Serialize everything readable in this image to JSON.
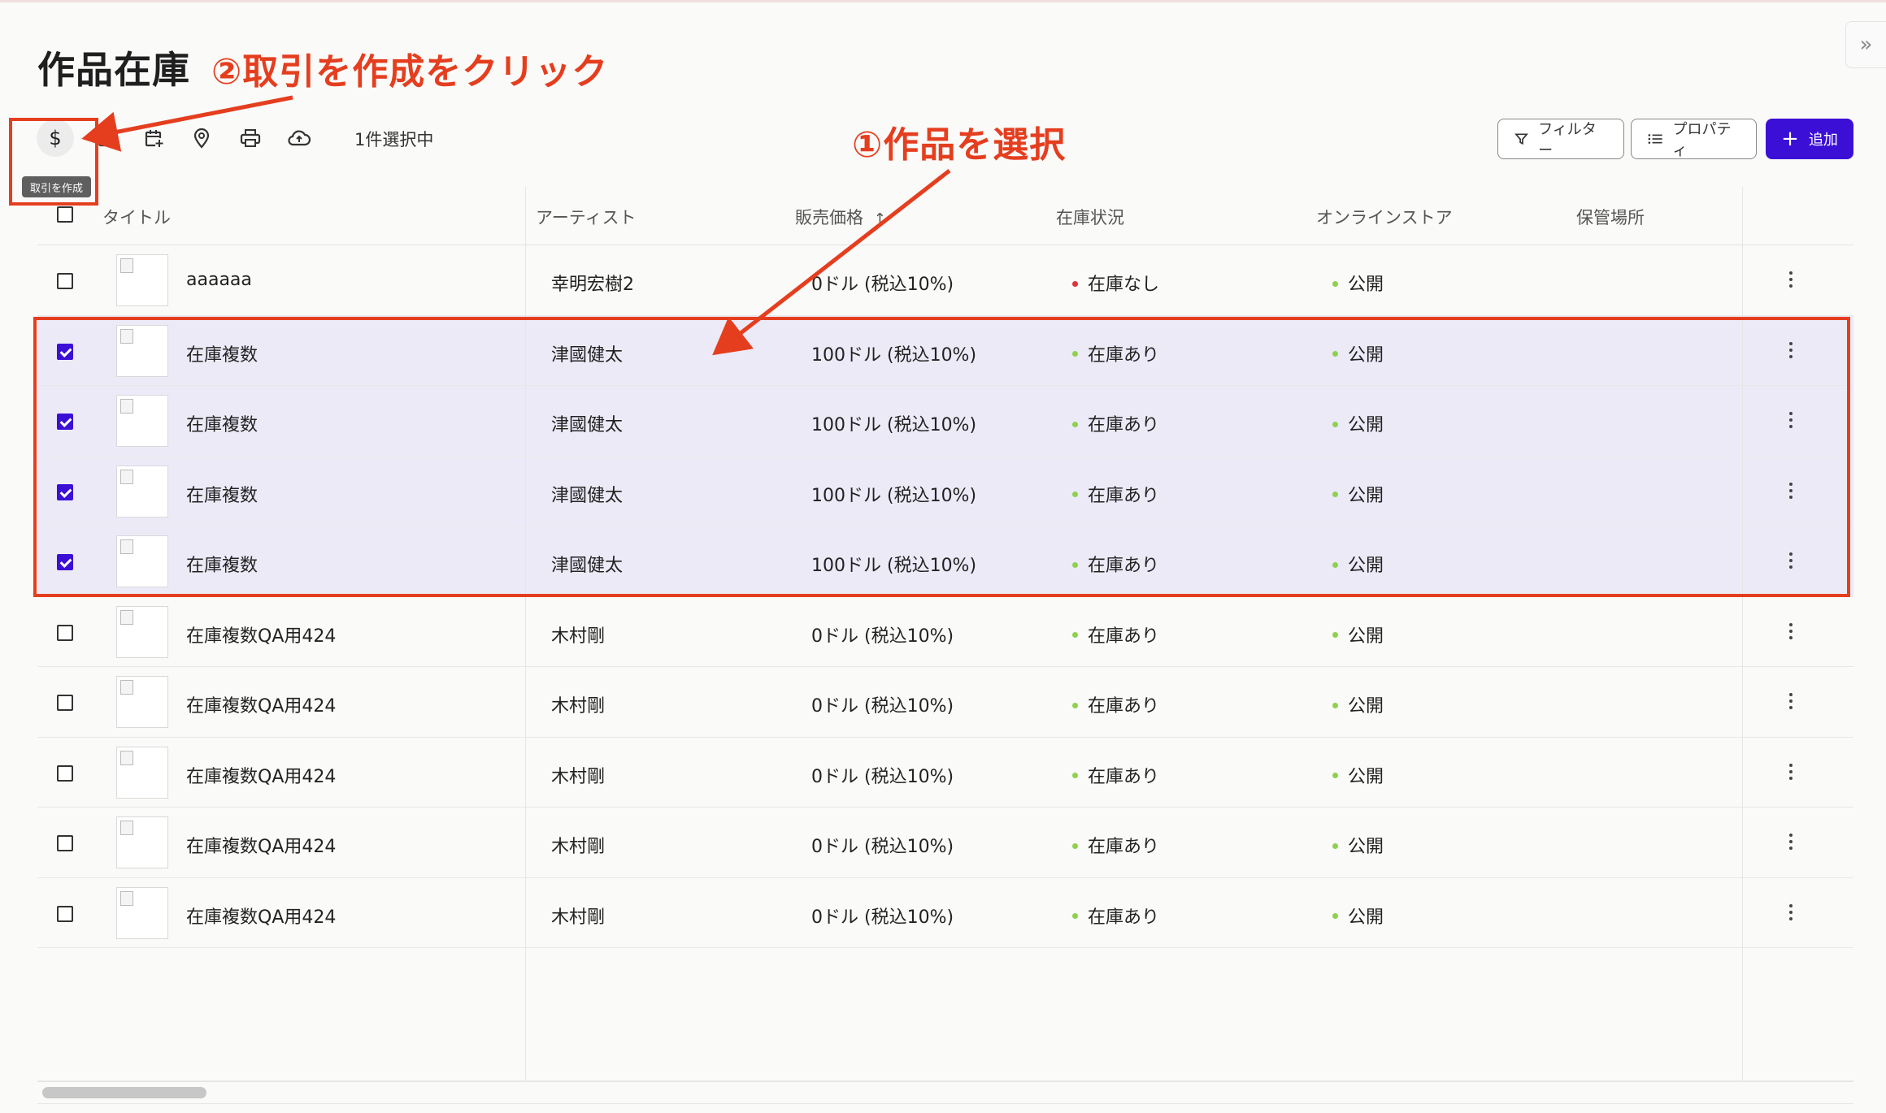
{
  "page_title": "作品在庫",
  "toolbar": {
    "tooltip": "取引を作成",
    "selection_count": "1件選択中",
    "filter_label": "フィルター",
    "property_label": "プロパティ",
    "add_label": "追加"
  },
  "annotations": {
    "step2": "②取引を作成をクリック",
    "step1": "①作品を選択"
  },
  "table": {
    "headers": {
      "title": "タイトル",
      "artist": "アーティスト",
      "price": "販売価格",
      "stock": "在庫状況",
      "store": "オンラインストア",
      "location": "保管場所"
    },
    "rows": [
      {
        "title": "aaaaaa",
        "artist": "幸明宏樹2",
        "price": "0ドル (税込10%)",
        "stock": "在庫なし",
        "store": "公開",
        "checked": false
      },
      {
        "title": "在庫複数",
        "artist": "津國健太",
        "price": "100ドル (税込10%)",
        "stock": "在庫あり",
        "store": "公開",
        "checked": true
      },
      {
        "title": "在庫複数",
        "artist": "津國健太",
        "price": "100ドル (税込10%)",
        "stock": "在庫あり",
        "store": "公開",
        "checked": true
      },
      {
        "title": "在庫複数",
        "artist": "津國健太",
        "price": "100ドル (税込10%)",
        "stock": "在庫あり",
        "store": "公開",
        "checked": true
      },
      {
        "title": "在庫複数",
        "artist": "津國健太",
        "price": "100ドル (税込10%)",
        "stock": "在庫あり",
        "store": "公開",
        "checked": true
      },
      {
        "title": "在庫複数QA用424",
        "artist": "木村剛",
        "price": "0ドル (税込10%)",
        "stock": "在庫あり",
        "store": "公開",
        "checked": false
      },
      {
        "title": "在庫複数QA用424",
        "artist": "木村剛",
        "price": "0ドル (税込10%)",
        "stock": "在庫あり",
        "store": "公開",
        "checked": false
      },
      {
        "title": "在庫複数QA用424",
        "artist": "木村剛",
        "price": "0ドル (税込10%)",
        "stock": "在庫あり",
        "store": "公開",
        "checked": false
      },
      {
        "title": "在庫複数QA用424",
        "artist": "木村剛",
        "price": "0ドル (税込10%)",
        "stock": "在庫あり",
        "store": "公開",
        "checked": false
      },
      {
        "title": "在庫複数QA用424",
        "artist": "木村剛",
        "price": "0ドル (税込10%)",
        "stock": "在庫あり",
        "store": "公開",
        "checked": false
      }
    ]
  },
  "colors": {
    "accent": "#3b0fd6",
    "annotation": "#e53e1f",
    "in_stock_dot": "#8fd14f",
    "out_of_stock_dot": "#e0333a",
    "public_dot": "#8fd14f",
    "selected_row_bg": "#edeaf8"
  },
  "icons": [
    "dollar-icon",
    "calendar-icon",
    "calendar-add-icon",
    "location-pin-icon",
    "printer-icon",
    "cloud-upload-icon",
    "filter-icon",
    "list-icon",
    "plus-icon",
    "sort-up-icon",
    "kebab-menu-icon",
    "double-chevron-right-icon"
  ]
}
